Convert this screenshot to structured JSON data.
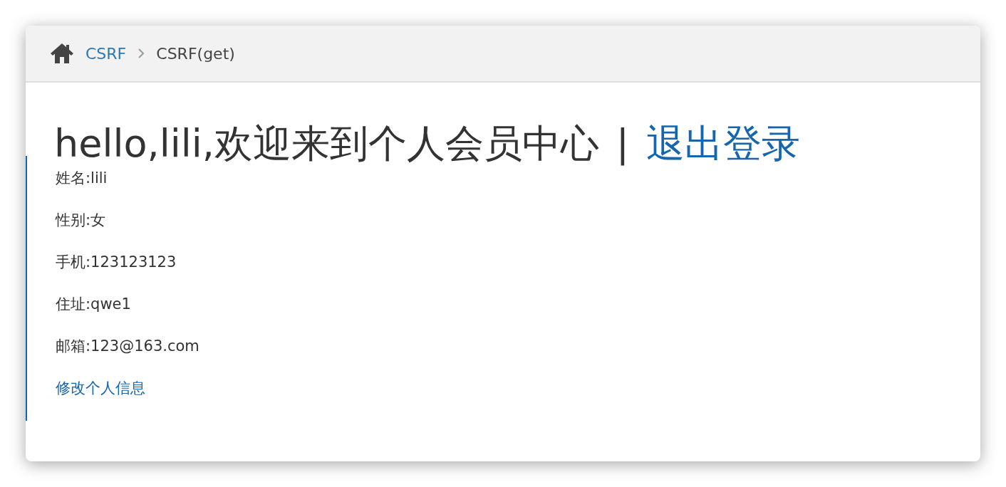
{
  "breadcrumb": [
    {
      "label": "CSRF",
      "kind": "link"
    },
    {
      "label": "CSRF(get)",
      "kind": "current"
    }
  ],
  "heading": {
    "greeting": "hello,lili,欢迎来到个人会员中心",
    "separator": "|",
    "logout": "退出登录"
  },
  "fields": [
    {
      "text": "姓名:lili"
    },
    {
      "text": "性别:女"
    },
    {
      "text": "手机:123123123"
    },
    {
      "text": "住址:qwe1"
    },
    {
      "text": "邮箱:123@163.com"
    }
  ],
  "edit_link": "修改个人信息"
}
